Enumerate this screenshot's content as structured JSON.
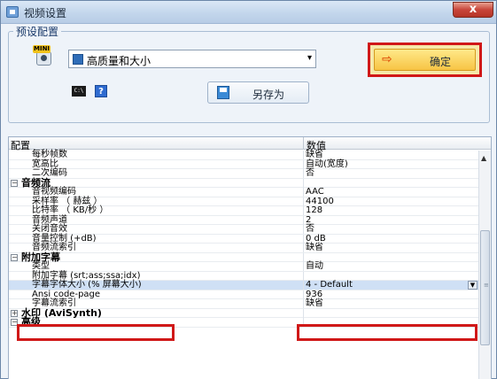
{
  "window": {
    "title": "视频设置",
    "close_glyph": "x"
  },
  "preset": {
    "group_label": "预设配置",
    "mini_badge": "MINI",
    "selected_value": "高质量和大小",
    "dropdown_arrow": "▾",
    "cmd_icon_text": "C:\\",
    "help_icon_text": "?",
    "save_as_label": "另存为",
    "ok_label": "确定",
    "ok_arrow": "⇨"
  },
  "config": {
    "col_name": "配置",
    "col_value": "数值",
    "rows": [
      {
        "name": "每秒帧数",
        "value": "缺省"
      },
      {
        "name": "宽高比",
        "value": "自动(宽度)"
      },
      {
        "name": "二次编码",
        "value": "否"
      },
      {
        "name": "音频流",
        "value": "",
        "category": true,
        "toggle": "−"
      },
      {
        "name": "音视频编码",
        "value": "AAC"
      },
      {
        "name": "采样率 （ 赫兹 ）",
        "value": "44100"
      },
      {
        "name": "比特率 （ KB/秒 ）",
        "value": "128"
      },
      {
        "name": "音频声道",
        "value": "2"
      },
      {
        "name": "关闭音效",
        "value": "否"
      },
      {
        "name": "音量控制 (+dB)",
        "value": "0 dB"
      },
      {
        "name": "音频流索引",
        "value": "缺省"
      },
      {
        "name": "附加字幕",
        "value": "",
        "category": true,
        "toggle": "−"
      },
      {
        "name": "类型",
        "value": "自动"
      },
      {
        "name": "附加字幕 (srt;ass;ssa;idx)",
        "value": ""
      },
      {
        "name": "字幕字体大小 (% 屏幕大小)",
        "value": "4 - Default",
        "highlight": true,
        "dropdown": true
      },
      {
        "name": "Ansi code-page",
        "value": "936"
      },
      {
        "name": "字幕流索引",
        "value": "缺省"
      },
      {
        "name": "水印 (AviSynth)",
        "value": "",
        "category": true,
        "toggle": "+"
      },
      {
        "name": "高级",
        "value": "",
        "category": true,
        "toggle": "−"
      }
    ]
  },
  "scrollbar": {
    "up_arrow": "▲",
    "grip": "≡"
  }
}
